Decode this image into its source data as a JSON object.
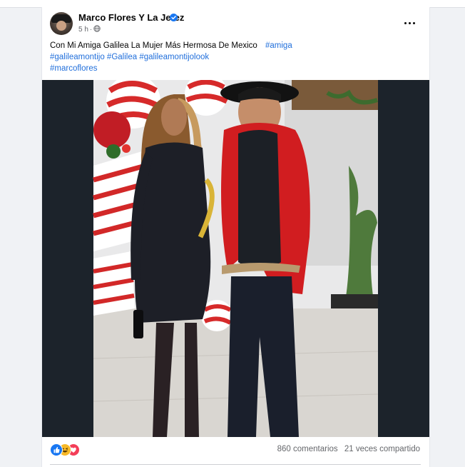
{
  "post": {
    "author": "Marco Flores Y La Jerez",
    "time": "5 h",
    "separator": "·",
    "text_line1": "Con Mi Amiga Galilea La Mujer Más Hermosa De Mexico",
    "hashtags_line1": [
      "#amiga"
    ],
    "hashtags_line2": [
      "#galileamontijo",
      "#Galilea",
      "#galileamontijolook"
    ],
    "hashtags_line3": [
      "#marcoflores"
    ],
    "comments": "860 comentarios",
    "shares": "21 veces compartido",
    "reactions": [
      "like-icon",
      "haha-icon",
      "love-icon"
    ]
  },
  "icons": {
    "verified": "verified-badge-icon",
    "audience": "globe-icon",
    "menu": "more-options-icon"
  },
  "colors": {
    "link": "#216fdb",
    "verified": "#1877f2",
    "like": "#1877f2",
    "haha": "#f7b928",
    "love": "#f33e58"
  }
}
